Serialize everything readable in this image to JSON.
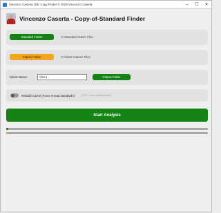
{
  "window": {
    "title": "Vincenzo Caserta JDE Copy Finder © 2026 Vincenzo Caserta",
    "minimize_glyph": "–",
    "maximize_glyph": "☐",
    "close_glyph": "✕"
  },
  "header": {
    "title": "Vincenzo Caserta - Copy-of-Standard Finder"
  },
  "standard": {
    "button_label": "Standard Folder",
    "path": "C:\\Standard Oracle Files"
  },
  "copies": {
    "button_label": "Copies Folder",
    "path": "C:\\Client Custom Files"
  },
  "client": {
    "label": "Client Name:",
    "value": "Client",
    "output_button_label": "Output Folder"
  },
  "cache": {
    "label": "Rebuild Cache (Force reread standards)",
    "hint": "(OFF = use existing cache)",
    "enabled": false
  },
  "start": {
    "label": "Start Analysis"
  },
  "progress": {
    "bar1_fraction": 0.01,
    "bar2_fraction": 0.01
  },
  "colors": {
    "green": "#148214",
    "orange": "#f5a51b"
  }
}
